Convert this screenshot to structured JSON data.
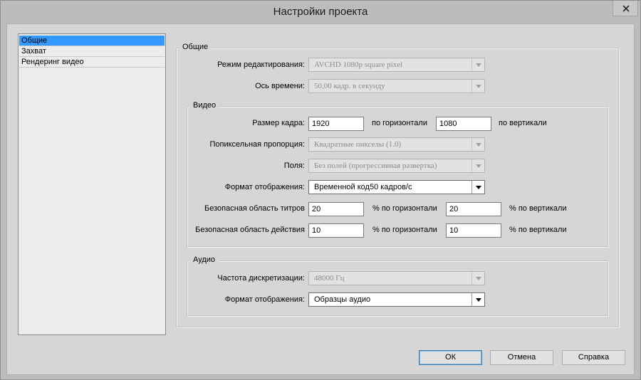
{
  "window": {
    "title": "Настройки проекта"
  },
  "nav": {
    "items": [
      {
        "label": "Общие",
        "selected": true
      },
      {
        "label": "Захват",
        "selected": false
      },
      {
        "label": "Рендеринг видео",
        "selected": false
      }
    ]
  },
  "general": {
    "title": "Общие",
    "edit_mode_label": "Режим редактирования:",
    "edit_mode_value": "AVCHD 1080p square pixel",
    "timeline_label": "Ось времени:",
    "timeline_value": "50,00 кадр. в секунду"
  },
  "video": {
    "title": "Видео",
    "frame_size_label": "Размер кадра:",
    "frame_width": "1920",
    "horizontal_label": "по горизонтали",
    "frame_height": "1080",
    "vertical_label": "по вертикали",
    "pixel_aspect_label": "Попиксельная пропорция:",
    "pixel_aspect_value": "Квадратные пикселы (1.0)",
    "fields_label": "Поля:",
    "fields_value": "Без полей (прогрессивная развертка)",
    "display_format_label": "Формат отображения:",
    "display_format_value": "Временной код50 кадров/с",
    "title_safe_label": "Безопасная область титров",
    "title_safe_h": "20",
    "title_safe_h_unit": "% по горизонтали",
    "title_safe_v": "20",
    "title_safe_v_unit": "% по вертикали",
    "action_safe_label": "Безопасная область действия",
    "action_safe_h": "10",
    "action_safe_h_unit": "% по горизонтали",
    "action_safe_v": "10",
    "action_safe_v_unit": "% по вертикали"
  },
  "audio": {
    "title": "Аудио",
    "sample_rate_label": "Частота дискретизации:",
    "sample_rate_value": "48000 Гц",
    "display_format_label": "Формат отображения:",
    "display_format_value": "Образцы аудио"
  },
  "buttons": {
    "ok": "ОК",
    "cancel": "Отмена",
    "help": "Справка"
  },
  "colors": {
    "selection": "#3399ff",
    "close_button": "#c7c7c7",
    "dialog_bg": "#d6d6d6"
  }
}
